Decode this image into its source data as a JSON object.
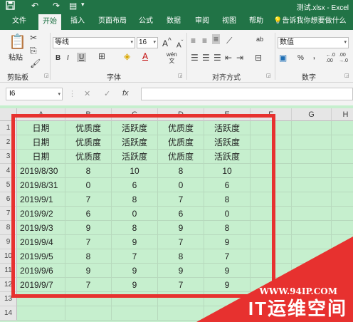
{
  "title_bar": {
    "filename": "测试.xlsx - Excel",
    "quick_access": [
      "save-icon",
      "undo-icon",
      "redo-icon",
      "form-icon"
    ]
  },
  "tabs": [
    "文件",
    "开始",
    "插入",
    "页面布局",
    "公式",
    "数据",
    "审阅",
    "视图",
    "帮助"
  ],
  "active_tab": "开始",
  "tell_me": "告诉我你想要做什么",
  "ribbon": {
    "clipboard": {
      "label": "剪贴板",
      "paste": "粘贴"
    },
    "font": {
      "label": "字体",
      "name": "等线",
      "size": "16",
      "bold": "B",
      "italic": "I",
      "underline": "U",
      "grow": "A",
      "shrink": "A",
      "wen": "wén",
      "wen_sub": "文"
    },
    "alignment": {
      "label": "对齐方式",
      "wrap": "ab"
    },
    "number": {
      "label": "数字",
      "format": "数值",
      "percent": "%",
      "comma": ",",
      "inc_decimal": "←.0 .00",
      "dec_decimal": ".00 →.0"
    }
  },
  "formula_bar": {
    "name_box": "I6",
    "cancel": "✕",
    "enter": "✓",
    "fx": "fx",
    "formula": ""
  },
  "colors": {
    "accent": "#217346",
    "sheet_bg": "#c6efce",
    "highlight": "#e7312f"
  },
  "columns": [
    "A",
    "B",
    "C",
    "D",
    "E",
    "F",
    "G",
    "H"
  ],
  "rows": [
    {
      "num": "1",
      "cells": [
        "日期",
        "优质度",
        "活跃度",
        "优质度",
        "活跃度"
      ]
    },
    {
      "num": "2",
      "cells": [
        "日期",
        "优质度",
        "活跃度",
        "优质度",
        "活跃度"
      ]
    },
    {
      "num": "3",
      "cells": [
        "日期",
        "优质度",
        "活跃度",
        "优质度",
        "活跃度"
      ]
    },
    {
      "num": "4",
      "cells": [
        "2019/8/30",
        "8",
        "10",
        "8",
        "10"
      ]
    },
    {
      "num": "5",
      "cells": [
        "2019/8/31",
        "0",
        "6",
        "0",
        "6"
      ]
    },
    {
      "num": "6",
      "cells": [
        "2019/9/1",
        "7",
        "8",
        "7",
        "8"
      ]
    },
    {
      "num": "7",
      "cells": [
        "2019/9/2",
        "6",
        "0",
        "6",
        "0"
      ]
    },
    {
      "num": "8",
      "cells": [
        "2019/9/3",
        "9",
        "8",
        "9",
        "8"
      ]
    },
    {
      "num": "9",
      "cells": [
        "2019/9/4",
        "7",
        "9",
        "7",
        "9"
      ]
    },
    {
      "num": "10",
      "cells": [
        "2019/9/5",
        "8",
        "7",
        "8",
        "7"
      ]
    },
    {
      "num": "11",
      "cells": [
        "2019/9/6",
        "9",
        "9",
        "9",
        "9"
      ]
    },
    {
      "num": "12",
      "cells": [
        "2019/9/7",
        "7",
        "9",
        "7",
        "9"
      ]
    },
    {
      "num": "13",
      "cells": [
        "",
        "",
        "",
        "",
        ""
      ]
    },
    {
      "num": "14",
      "cells": [
        "",
        "",
        "",
        "",
        ""
      ]
    }
  ],
  "watermark": {
    "url": "WWW.94IP.COM",
    "brand": "IT运维空间"
  }
}
